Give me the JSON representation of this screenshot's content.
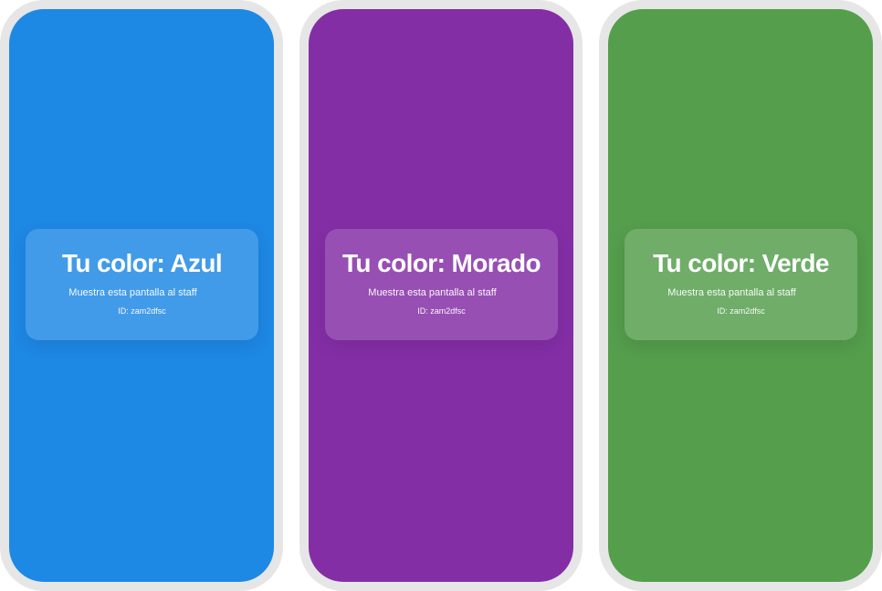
{
  "phones": [
    {
      "title": "Tu color: Azul",
      "subtitle": "Muestra esta pantalla al staff",
      "id_text": "ID: zam2dfsc",
      "color": "#1e88e5"
    },
    {
      "title": "Tu color: Morado",
      "subtitle": "Muestra esta pantalla al staff",
      "id_text": "ID: zam2dfsc",
      "color": "#842ea6"
    },
    {
      "title": "Tu color: Verde",
      "subtitle": "Muestra esta pantalla al staff",
      "id_text": "ID: zam2dfsc",
      "color": "#549e4c"
    }
  ]
}
